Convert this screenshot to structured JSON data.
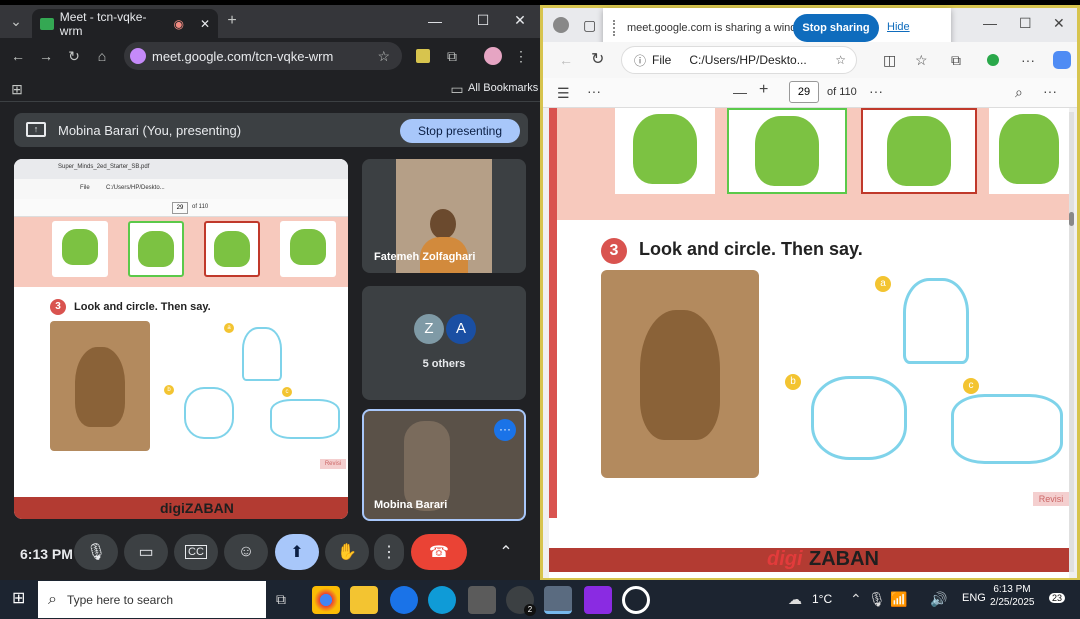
{
  "left_window": {
    "tab_title": "Meet - tcn-vqke-wrm",
    "url": "meet.google.com/tcn-vqke-wrm",
    "bookmarks_label": "All Bookmarks"
  },
  "meet": {
    "presenting_text": "Mobina Barari (You, presenting)",
    "stop_presenting_label": "Stop presenting",
    "participants": [
      {
        "name": "Fatemeh Zolfaghari"
      },
      {
        "name": "5 others",
        "avatars": [
          "Z",
          "A"
        ]
      },
      {
        "name": "Mobina Barari"
      }
    ],
    "time": "6:13 PM"
  },
  "shared_screen": {
    "tab_title": "Super_Minds_2ed_Starter_SB.pdf",
    "file_label": "File",
    "path": "C:/Users/HP/Deskto...",
    "page": "29",
    "of_pages": "of 110",
    "exercise": "Look and circle. Then say.",
    "exercise_number": "3",
    "options": [
      "a",
      "b",
      "c"
    ],
    "footer_tag": "Revisi",
    "brand": "digiZABAN"
  },
  "right_window": {
    "sharing_text": "meet.google.com is sharing a window.",
    "stop_sharing_label": "Stop sharing",
    "hide_label": "Hide",
    "file_label": "File",
    "path": "C:/Users/HP/Deskto...",
    "page": "29",
    "of_pages": "of 110",
    "exercise_number": "3",
    "exercise": "Look and circle. Then say.",
    "options": [
      "a",
      "b",
      "c"
    ],
    "footer_tag": "Revisi",
    "brand_digi": "digi",
    "brand_zaban": "ZABAN"
  },
  "taskbar": {
    "search_placeholder": "Type here to search",
    "temperature": "1°C",
    "language": "ENG",
    "time": "6:13 PM",
    "date": "2/25/2025",
    "notifications": "23",
    "chrome_badge": "2"
  },
  "colors": {
    "accent_blue": "#a8c7fa",
    "stop_red": "#ea4335",
    "edge_blue": "#0f6cbd",
    "highlight_border": "#d7c44e"
  }
}
